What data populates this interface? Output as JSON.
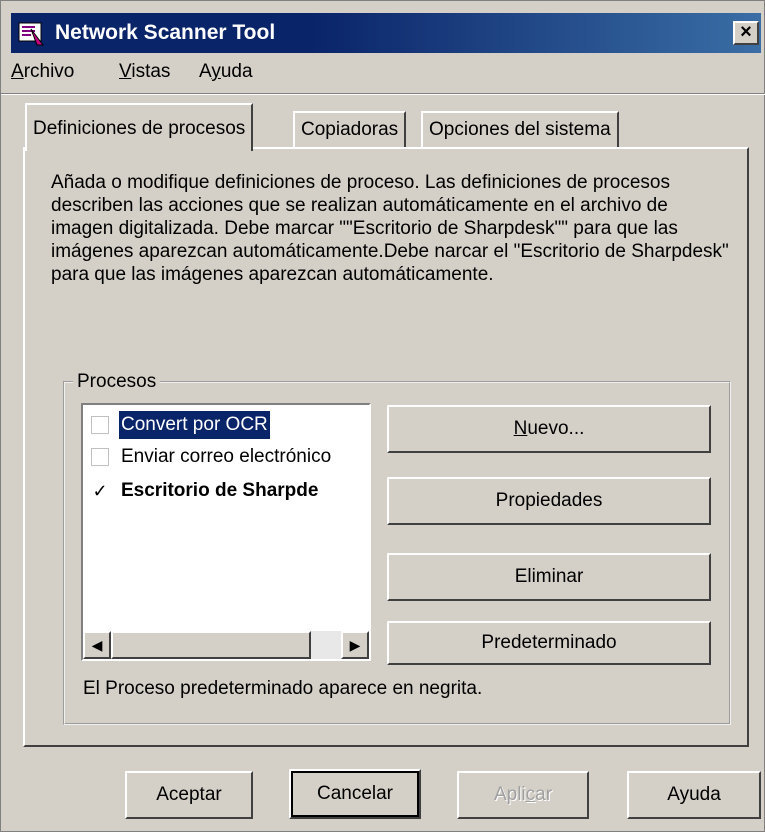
{
  "window": {
    "title": "Network Scanner Tool",
    "icon": "scanner-app-icon",
    "close_glyph": "×"
  },
  "menu": [
    {
      "pre": "",
      "key": "A",
      "post": "rchivo"
    },
    {
      "pre": "",
      "key": "V",
      "post": "istas"
    },
    {
      "pre": "A",
      "key": "y",
      "post": "uda"
    }
  ],
  "tabs": [
    {
      "label": "Definiciones de procesos",
      "active": true
    },
    {
      "label": "Copiadoras",
      "active": false
    },
    {
      "label": "Opciones del sistema",
      "active": false
    }
  ],
  "description": "Añada o modifique definiciones de proceso. Las definiciones de procesos describen las acciones que se realizan automáticamente en el archivo de imagen digitalizada. Debe marcar \"\"Escritorio de Sharpdesk\"\" para que las imágenes aparezcan automáticamente.Debe narcar el \"Escritorio de Sharpdesk\" para que las imágenes aparezcan automáticamente.",
  "processes": {
    "legend": "Procesos",
    "items": [
      {
        "label": "Convert por OCR",
        "checked": false,
        "selected": true,
        "bold": false
      },
      {
        "label": "Enviar correo electrónico",
        "checked": false,
        "selected": false,
        "bold": false
      },
      {
        "label": "Escritorio de Sharpde",
        "checked": true,
        "selected": false,
        "bold": true
      }
    ],
    "check_glyph": "✓",
    "scroll_left": "◀",
    "scroll_right": "▶",
    "buttons": {
      "new": {
        "key": "N",
        "rest": "uevo..."
      },
      "properties": "Propiedades",
      "delete": "Eliminar",
      "default": "Predeterminado"
    },
    "note": "El Proceso predeterminado aparece en negrita."
  },
  "footer": {
    "ok": "Aceptar",
    "cancel": "Cancelar",
    "apply_pre": "Apli",
    "apply_key": "c",
    "apply_post": "ar",
    "help": "Ayuda"
  }
}
